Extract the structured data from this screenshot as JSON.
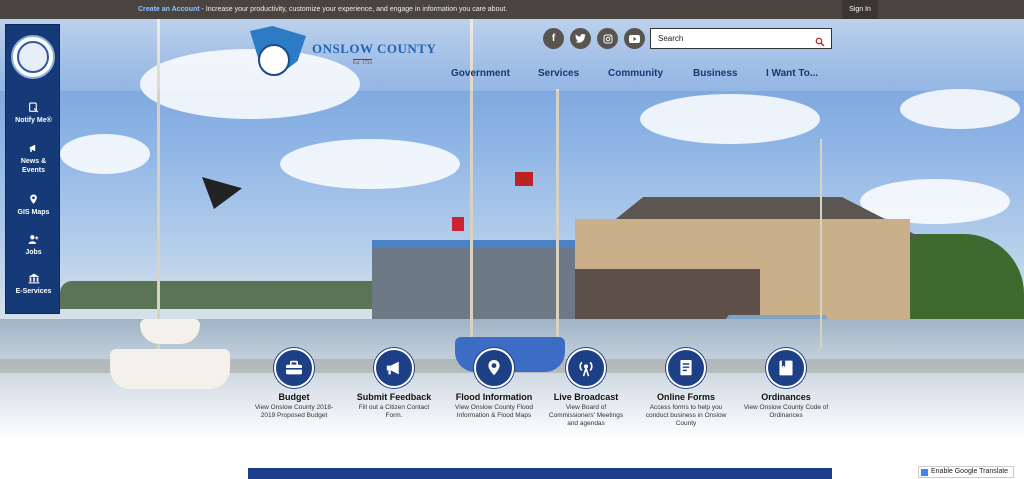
{
  "topbar": {
    "create_account": "Create an Account",
    "message": " - Increase your productivity, customize your experience, and engage in information you care about.",
    "sign_in": "Sign In"
  },
  "logo": {
    "title": "ONSLOW COUNTY",
    "established": "Est. 1734"
  },
  "search": {
    "placeholder": "Search"
  },
  "social": [
    "facebook-icon",
    "twitter-icon",
    "instagram-icon",
    "youtube-icon"
  ],
  "nav": [
    "Government",
    "Services",
    "Community",
    "Business",
    "I Want To..."
  ],
  "sidebar": [
    {
      "label": "Notify Me®",
      "icon": "notify-icon"
    },
    {
      "label": "News & Events",
      "icon": "news-icon"
    },
    {
      "label": "GIS Maps",
      "icon": "map-pin-icon"
    },
    {
      "label": "Jobs",
      "icon": "jobs-icon"
    },
    {
      "label": "E-Services",
      "icon": "building-icon"
    }
  ],
  "quicklinks": [
    {
      "title": "Budget",
      "desc": "View Onslow County 2018-2019 Proposed Budget",
      "icon": "briefcase-icon"
    },
    {
      "title": "Submit Feedback",
      "desc": "Fill out a Citizen Contact Form.",
      "icon": "megaphone-icon"
    },
    {
      "title": "Flood Information",
      "desc": "View Onslow County Flood Information & Flood Maps",
      "icon": "location-icon"
    },
    {
      "title": "Live Broadcast",
      "desc": "View Board of Commissioners' Meetings and agendas",
      "icon": "broadcast-icon"
    },
    {
      "title": "Online Forms",
      "desc": "Access forms to help you conduct business in Onslow County",
      "icon": "document-icon"
    },
    {
      "title": "Ordinances",
      "desc": "View Onslow County Code of Ordinances",
      "icon": "book-icon"
    }
  ],
  "translate": {
    "label": "Enable Google Translate"
  },
  "colors": {
    "brand_navy": "#1d3f86",
    "topbar": "#4a4440",
    "logo_blue": "#2464b3"
  }
}
